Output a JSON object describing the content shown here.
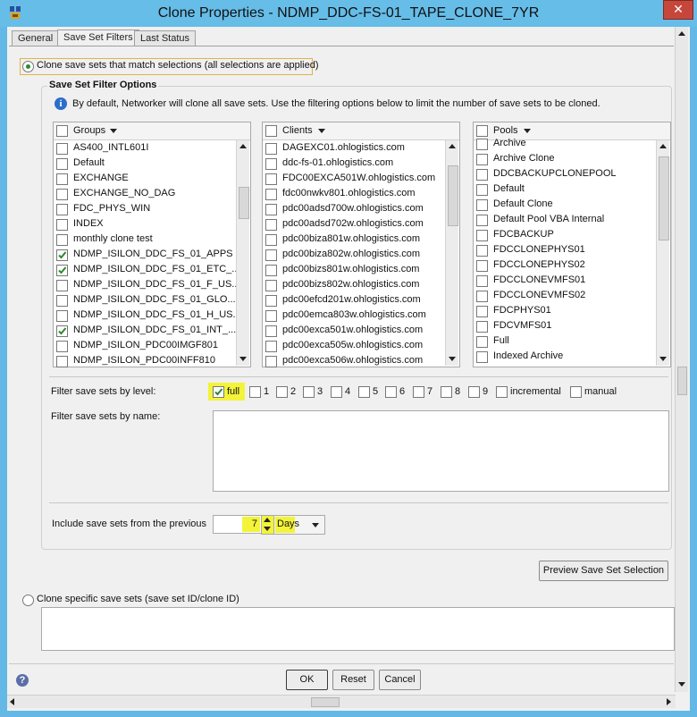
{
  "window": {
    "title": "Clone Properties - NDMP_DDC-FS-01_TAPE_CLONE_7YR",
    "close_glyph": "✕"
  },
  "tabs": [
    {
      "label": "General"
    },
    {
      "label": "Save Set Filters"
    },
    {
      "label": "Last Status"
    }
  ],
  "mode": {
    "match_label": "Clone save sets that match selections (all selections are applied)",
    "specific_label": "Clone specific save sets (save set ID/clone ID)"
  },
  "filter_options": {
    "group_title": "Save Set Filter Options",
    "info_text": "By default, Networker will clone all save sets. Use the filtering options below to limit the number of save sets to be cloned."
  },
  "groups": {
    "header": "Groups",
    "items": [
      {
        "label": "AS400_INTL601I",
        "checked": false
      },
      {
        "label": "Default",
        "checked": false
      },
      {
        "label": "EXCHANGE",
        "checked": false
      },
      {
        "label": "EXCHANGE_NO_DAG",
        "checked": false
      },
      {
        "label": "FDC_PHYS_WIN",
        "checked": false
      },
      {
        "label": "INDEX",
        "checked": false
      },
      {
        "label": "monthly clone test",
        "checked": false
      },
      {
        "label": "NDMP_ISILON_DDC_FS_01_APPS",
        "checked": true
      },
      {
        "label": "NDMP_ISILON_DDC_FS_01_ETC_...",
        "checked": true
      },
      {
        "label": "NDMP_ISILON_DDC_FS_01_F_US...",
        "checked": false
      },
      {
        "label": "NDMP_ISILON_DDC_FS_01_GLO...",
        "checked": false
      },
      {
        "label": "NDMP_ISILON_DDC_FS_01_H_US...",
        "checked": false
      },
      {
        "label": "NDMP_ISILON_DDC_FS_01_INT_...",
        "checked": true
      },
      {
        "label": "NDMP_ISILON_PDC00IMGF801",
        "checked": false
      },
      {
        "label": "NDMP_ISILON_PDC00INFF810",
        "checked": false
      }
    ]
  },
  "clients": {
    "header": "Clients",
    "items": [
      {
        "label": "DAGEXC01.ohlogistics.com"
      },
      {
        "label": "ddc-fs-01.ohlogistics.com"
      },
      {
        "label": "FDC00EXCA501W.ohlogistics.com"
      },
      {
        "label": "fdc00nwkv801.ohlogistics.com"
      },
      {
        "label": "pdc00adsd700w.ohlogistics.com"
      },
      {
        "label": "pdc00adsd702w.ohlogistics.com"
      },
      {
        "label": "pdc00biza801w.ohlogistics.com"
      },
      {
        "label": "pdc00biza802w.ohlogistics.com"
      },
      {
        "label": "pdc00bizs801w.ohlogistics.com"
      },
      {
        "label": "pdc00bizs802w.ohlogistics.com"
      },
      {
        "label": "pdc00efcd201w.ohlogistics.com"
      },
      {
        "label": "pdc00emca803w.ohlogistics.com"
      },
      {
        "label": "pdc00exca501w.ohlogistics.com"
      },
      {
        "label": "pdc00exca505w.ohlogistics.com"
      },
      {
        "label": "pdc00exca506w.ohlogistics.com"
      }
    ]
  },
  "pools": {
    "header": "Pools",
    "items": [
      {
        "label": "Archive"
      },
      {
        "label": "Archive Clone"
      },
      {
        "label": "DDCBACKUPCLONEPOOL"
      },
      {
        "label": "Default"
      },
      {
        "label": "Default Clone"
      },
      {
        "label": "Default Pool VBA Internal"
      },
      {
        "label": "FDCBACKUP"
      },
      {
        "label": "FDCCLONEPHYS01"
      },
      {
        "label": "FDCCLONEPHYS02"
      },
      {
        "label": "FDCCLONEVMFS01"
      },
      {
        "label": "FDCCLONEVMFS02"
      },
      {
        "label": "FDCPHYS01"
      },
      {
        "label": "FDCVMFS01"
      },
      {
        "label": "Full"
      },
      {
        "label": "Indexed Archive"
      }
    ]
  },
  "level_filter": {
    "label": "Filter save sets by level:",
    "levels": [
      {
        "label": "full",
        "checked": true
      },
      {
        "label": "1",
        "checked": false
      },
      {
        "label": "2",
        "checked": false
      },
      {
        "label": "3",
        "checked": false
      },
      {
        "label": "4",
        "checked": false
      },
      {
        "label": "5",
        "checked": false
      },
      {
        "label": "6",
        "checked": false
      },
      {
        "label": "7",
        "checked": false
      },
      {
        "label": "8",
        "checked": false
      },
      {
        "label": "9",
        "checked": false
      },
      {
        "label": "incremental",
        "checked": false
      },
      {
        "label": "manual",
        "checked": false
      }
    ]
  },
  "name_filter": {
    "label": "Filter save sets by name:",
    "value": ""
  },
  "include_previous": {
    "label": "Include save sets from the previous",
    "value": "7",
    "unit": "Days"
  },
  "buttons": {
    "preview": "Preview Save Set Selection",
    "ok": "OK",
    "reset": "Reset",
    "cancel": "Cancel"
  },
  "help_glyph": "?",
  "colors": {
    "titlebar": "#66bde8",
    "highlight": "#f3f33a",
    "check": "#2b8a2b",
    "close": "#c7463b"
  }
}
